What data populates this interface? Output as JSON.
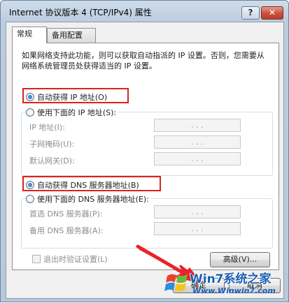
{
  "window": {
    "title": "Internet 协议版本 4 (TCP/IPv4) 属性",
    "help_label": "?",
    "close_label": "✕"
  },
  "tabs": [
    {
      "label": "常规",
      "active": true
    },
    {
      "label": "备用配置",
      "active": false
    }
  ],
  "description": "如果网络支持此功能，则可以获取自动指派的 IP 设置。否则，您需要从网络系统管理员处获得适当的 IP 设置。",
  "ip": {
    "auto_label": "自动获得 IP 地址(O)",
    "auto_checked": true,
    "manual_label": "使用下面的 IP 地址(S):",
    "fields": [
      {
        "label": "IP 地址(I):"
      },
      {
        "label": "子网掩码(U):"
      },
      {
        "label": "默认网关(D):"
      }
    ]
  },
  "dns": {
    "auto_label": "自动获得 DNS 服务器地址(B)",
    "auto_checked": true,
    "manual_label": "使用下面的 DNS 服务器地址(E):",
    "fields": [
      {
        "label": "首选 DNS 服务器(P):"
      },
      {
        "label": "备用 DNS 服务器(A):"
      }
    ]
  },
  "ip_dots": ".   .   .",
  "validate_label": "退出时验证设置(L)",
  "buttons": {
    "advanced": "高级(V)...",
    "ok": "确定",
    "cancel": "取消"
  },
  "watermark": {
    "line1": "Win7系统之家",
    "line2": "Www.Winwin7.com"
  },
  "colors": {
    "highlight_box": "#e0201c",
    "arrow": "#e8242a"
  }
}
